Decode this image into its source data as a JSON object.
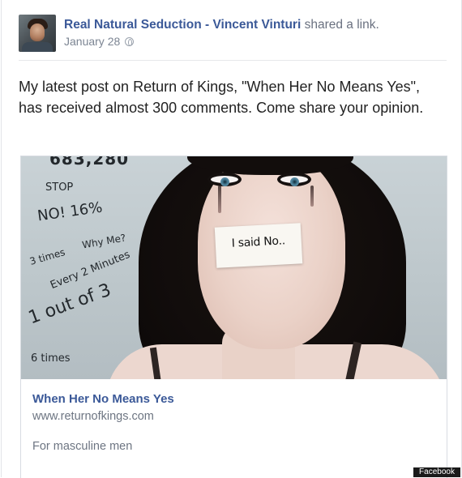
{
  "post": {
    "poster_name": "Real Natural Seduction - Vincent Vinturi",
    "action_text": " shared a link.",
    "date": "January 28",
    "message": "My latest post on Return of Kings, \"When Her No Means Yes\", has received almost 300 comments. Come share your opinion."
  },
  "attachment": {
    "image_words": [
      "683,280",
      "STOP",
      "NO! 16%",
      "Why Me?",
      "3 times",
      "Every 2 Minutes",
      "1 out of 3",
      "6 times"
    ],
    "tape_text": "I said No..",
    "title": "When Her No Means Yes",
    "url": "www.returnofkings.com",
    "description": "For masculine men"
  },
  "watermark": "Facebook",
  "icons": [
    "avatar",
    "globe-icon"
  ],
  "colors": {
    "link_blue": "#3b5998",
    "meta_gray": "#7c8593"
  }
}
